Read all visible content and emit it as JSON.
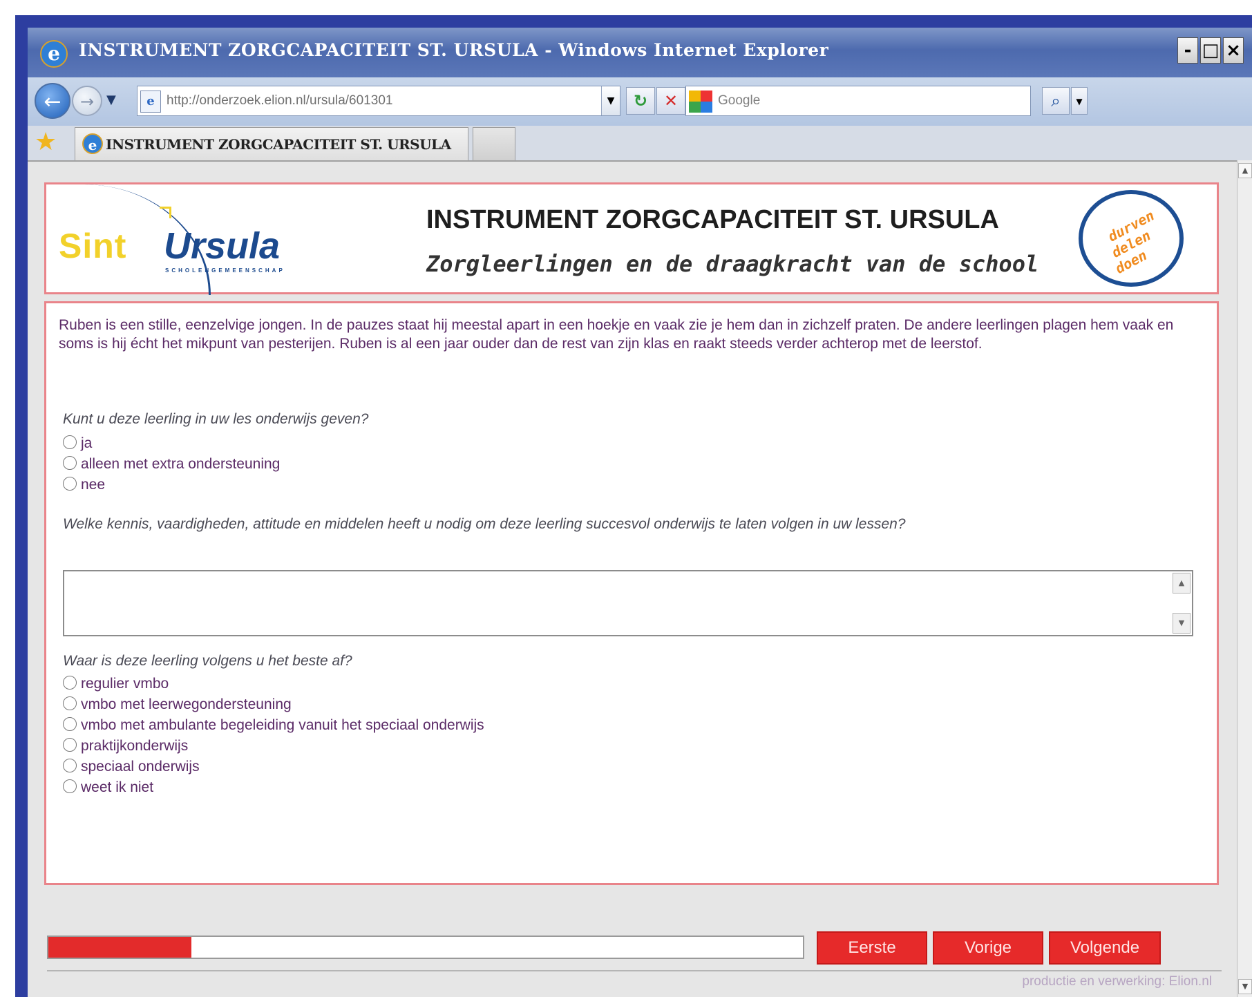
{
  "window": {
    "title": "INSTRUMENT ZORGCAPACITEIT ST. URSULA - Windows Internet Explorer",
    "controls": {
      "minimize": "-",
      "maximize": "□",
      "close": "×"
    }
  },
  "addressbar": {
    "url": "http://onderzoek.elion.nl/ursula/601301",
    "refresh_glyph": "↻",
    "stop_glyph": "✕"
  },
  "search": {
    "placeholder": "Google",
    "go_glyph": "⌕"
  },
  "tabs": [
    {
      "label": "INSTRUMENT ZORGCAPACITEIT ST. URSULA"
    }
  ],
  "header": {
    "logo": {
      "part1": "Sint",
      "part2": "Ursula",
      "sub": "SCHOLENGEMEENSCHAP"
    },
    "title": "INSTRUMENT ZORGCAPACITEIT ST. URSULA",
    "subtitle": "Zorgleerlingen en de draagkracht van de school",
    "badge": [
      "durven",
      "delen",
      "doen"
    ]
  },
  "case_text": "Ruben is een stille, eenzelvige jongen. In de pauzes staat hij meestal apart in een hoekje en vaak zie je hem dan in zichzelf praten. De andere leerlingen plagen hem vaak en soms is hij écht het mikpunt van pesterijen. Ruben is al een jaar ouder dan de rest van zijn klas en raakt steeds verder achterop met de leerstof.",
  "q1": {
    "label": "Kunt u deze leerling in uw les onderwijs geven?",
    "options": [
      "ja",
      "alleen met extra ondersteuning",
      "nee"
    ]
  },
  "q2": {
    "label": "Welke kennis, vaardigheden, attitude en middelen heeft u nodig om deze leerling succesvol onderwijs te laten volgen in uw lessen?",
    "value": ""
  },
  "q3": {
    "label": "Waar is deze leerling volgens u het beste af?",
    "options": [
      "regulier vmbo",
      "vmbo met leerwegondersteuning",
      "vmbo met ambulante begeleiding vanuit het speciaal onderwijs",
      "praktijkonderwijs",
      "speciaal onderwijs",
      "weet ik niet"
    ]
  },
  "progress": {
    "fraction": 0.19,
    "color": "#e32b2b"
  },
  "buttons": {
    "first": "Eerste",
    "prev": "Vorige",
    "next": "Volgende"
  },
  "footer": {
    "credit": "productie en verwerking: Elion.nl"
  },
  "colors": {
    "accent_red": "#e62a2a",
    "border_pink": "#e9848a",
    "brand_blue": "#1c4a8e",
    "brand_yellow": "#f2d12a"
  }
}
